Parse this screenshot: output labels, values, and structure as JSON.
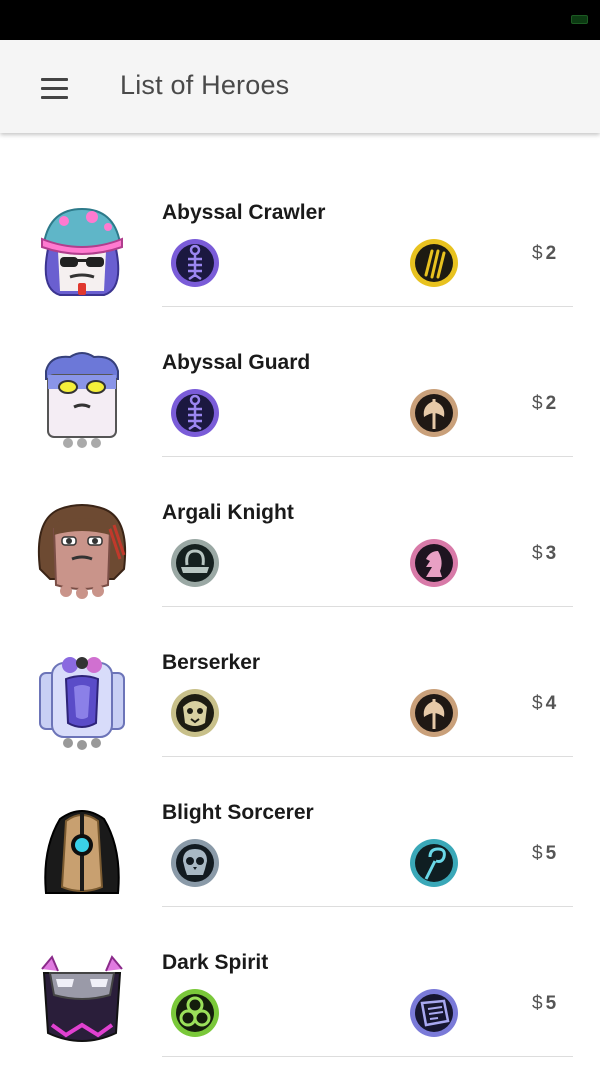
{
  "app": {
    "title": "List of Heroes"
  },
  "heroes": [
    {
      "name": "Abyssal Crawler",
      "cost": "2",
      "currency": "$",
      "portrait": "abyssal-crawler-portrait",
      "origin_icon": "fish-skeleton-icon",
      "class_icon": "claw-icon"
    },
    {
      "name": "Abyssal Guard",
      "cost": "2",
      "currency": "$",
      "portrait": "abyssal-guard-portrait",
      "origin_icon": "fish-skeleton-icon",
      "class_icon": "axe-icon"
    },
    {
      "name": "Argali Knight",
      "cost": "3",
      "currency": "$",
      "portrait": "argali-knight-portrait",
      "origin_icon": "horn-icon",
      "class_icon": "chess-knight-icon"
    },
    {
      "name": "Berserker",
      "cost": "4",
      "currency": "$",
      "portrait": "berserker-portrait",
      "origin_icon": "beast-face-icon",
      "class_icon": "axe-icon"
    },
    {
      "name": "Blight Sorcerer",
      "cost": "5",
      "currency": "$",
      "portrait": "blight-sorcerer-portrait",
      "origin_icon": "skull-icon",
      "class_icon": "staff-icon"
    },
    {
      "name": "Dark Spirit",
      "cost": "5",
      "currency": "$",
      "portrait": "dark-spirit-portrait",
      "origin_icon": "trefoil-icon",
      "class_icon": "spellbook-icon"
    }
  ],
  "colors": {
    "status_bar": "#000000",
    "app_bar": "#f5f5f5",
    "divider": "#dddddd"
  }
}
